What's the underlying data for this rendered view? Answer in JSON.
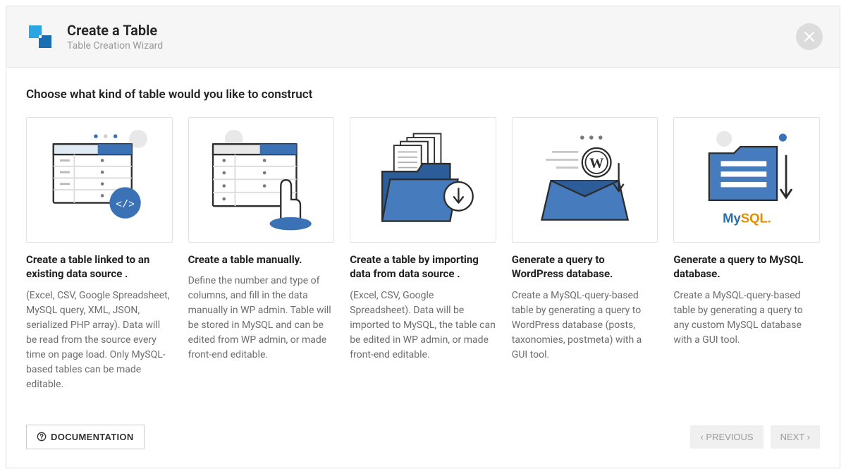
{
  "header": {
    "title": "Create a Table",
    "subtitle": "Table Creation Wizard"
  },
  "prompt": "Choose what kind of table would you like to construct",
  "cards": [
    {
      "title": "Create a table linked to an existing data source .",
      "desc": "(Excel, CSV, Google Spreadsheet, MySQL query, XML, JSON, serialized PHP array). Data will be read from the source every time on page load. Only MySQL-based tables can be made editable."
    },
    {
      "title": "Create a table manually.",
      "desc": "Define the number and type of columns, and fill in the data manually in WP admin. Table will be stored in MySQL and can be edited from WP admin, or made front-end editable."
    },
    {
      "title": "Create a table by importing data from data source .",
      "desc": "(Excel, CSV, Google Spreadsheet). Data will be imported to MySQL, the table can be edited in WP admin, or made front-end editable."
    },
    {
      "title": "Generate a query to WordPress database.",
      "desc": "Create a MySQL-query-based table by generating a query to WordPress database (posts, taxonomies, postmeta) with a GUI tool."
    },
    {
      "title": "Generate a query to MySQL database.",
      "desc": "Create a MySQL-query-based table by generating a query to any custom MySQL database with a GUI tool."
    }
  ],
  "footer": {
    "documentation": "DOCUMENTATION",
    "previous": "PREVIOUS",
    "next": "NEXT"
  },
  "mysql_label": {
    "my": "My",
    "sql": "SQL."
  }
}
